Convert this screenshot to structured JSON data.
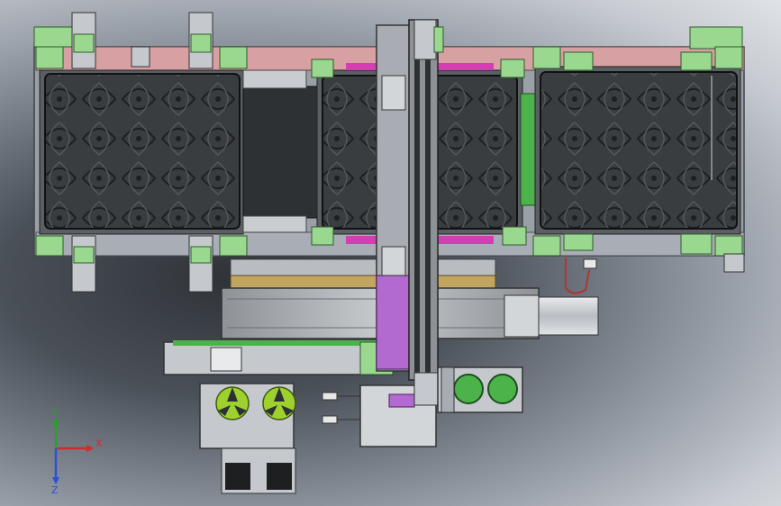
{
  "viewport": {
    "title": ""
  },
  "triad": {
    "x_label": "X",
    "y_label": "Y",
    "z_label": "Z"
  },
  "colors": {
    "frame_pink": "#d7a0a2",
    "bracket_green": "#9ad88f",
    "tray_dark": "#3a3d40",
    "rail_gray": "#a9adb3",
    "carriage_purple": "#b26ad0",
    "magenta_strip": "#d13fb3",
    "tan_plate": "#c2a560",
    "chuck_green": "#9ed12d",
    "motor_gray": "#d8dbde"
  }
}
